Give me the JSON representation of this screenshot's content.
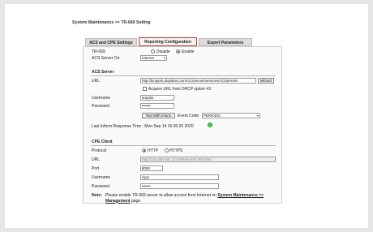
{
  "header": {
    "title": "System Maintenance >> TR-069 Setting"
  },
  "tabs": [
    {
      "label": "ACS and CPE Settings"
    },
    {
      "label": "Reporting Configuration"
    },
    {
      "label": "Export Parameters"
    }
  ],
  "tr069": {
    "label": "TR-069",
    "options": [
      "Disable",
      "Enable"
    ],
    "selected": "Enable",
    "acs_server_on_label": "ACS Server On",
    "acs_server_on_value": "Internet"
  },
  "acs_server": {
    "section_title": "ACS Server",
    "url_label": "URL",
    "url_value": "http://Draytek.draytdns.com/ACSServer/services/ACSServlet",
    "wizard_label": "Wizard",
    "dhcp_label": "Acquire URL from DHCP option 43",
    "username_label": "Username",
    "username_value": "draytek",
    "password_label": "Password",
    "password_value": "•••••••",
    "test_button": "Test With Inform",
    "event_code_label": "Event Code",
    "event_code_value": "PERIODIC",
    "last_inform": "Last Inform Response Time : Mon Sep 14 16:36:26 2020"
  },
  "cpe_client": {
    "section_title": "CPE Client",
    "protocol_label": "Protocol",
    "protocol_options": [
      "HTTP",
      "HTTPS"
    ],
    "protocol_selected": "HTTP",
    "url_label": "URL",
    "url_value": "http://123.456.654.121:8069/cwm/CRN.html",
    "port_label": "Port",
    "port_value": "8069",
    "username_label": "Username",
    "username_value": "vigor",
    "password_label": "Password",
    "password_value": "•••••••"
  },
  "note": {
    "label": "Note:",
    "text": "Please enable TR-069 server to allow access from Internet on",
    "link": "System Maintenance >> Management",
    "suffix": "page."
  },
  "colors": {
    "active_tab_border": "#c0392b",
    "status_ok": "#3fd24a",
    "radio_on": "#1a4fd6"
  }
}
